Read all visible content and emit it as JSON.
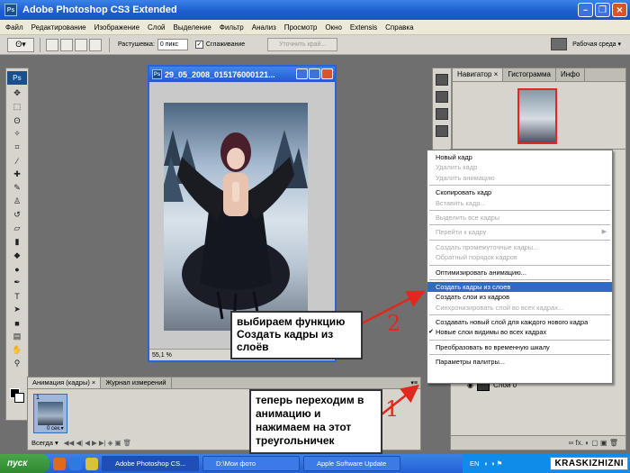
{
  "window": {
    "title": "Adobe Photoshop CS3 Extended",
    "app_icon": "Ps"
  },
  "menubar": {
    "items": [
      "Файл",
      "Редактирование",
      "Изображение",
      "Слой",
      "Выделение",
      "Фильтр",
      "Анализ",
      "Просмотр",
      "Окно",
      "Extensis",
      "Справка"
    ]
  },
  "options": {
    "feather_label": "Растушевка:",
    "feather_value": "0 пикс",
    "antialias_label": "Сглаживание",
    "antialias_checked": "✓",
    "refine_button": "Уточнить край...",
    "workspace_label": "Рабочая среда ▾"
  },
  "tools": {
    "logo": "Ps",
    "icons": [
      "move-icon",
      "marquee-icon",
      "lasso-icon",
      "magic-wand-icon",
      "crop-icon",
      "eyedropper-icon",
      "healing-icon",
      "brush-icon",
      "stamp-icon",
      "history-brush-icon",
      "eraser-icon",
      "gradient-icon",
      "blur-icon",
      "dodge-icon",
      "pen-icon",
      "type-icon",
      "path-select-icon",
      "shape-icon",
      "notes-icon",
      "hand-icon",
      "zoom-icon"
    ]
  },
  "document": {
    "title": "29_05_2008_015176000121...",
    "zoom": "55,1 %"
  },
  "navigator": {
    "tabs": [
      "Навигатор ×",
      "Гистограмма",
      "Инфо"
    ]
  },
  "layers": {
    "layer_name": "Слой 0",
    "bottom_icons": "∞  fx.  ◐  ▢  ▣  🗑"
  },
  "context_menu": {
    "items": [
      {
        "label": "Новый кадр",
        "enabled": true
      },
      {
        "label": "Удалить кадр",
        "enabled": false
      },
      {
        "label": "Удалить анимацию",
        "enabled": false
      },
      {
        "sep": true
      },
      {
        "label": "Скопировать кадр",
        "enabled": true
      },
      {
        "label": "Вставить кадр...",
        "enabled": false
      },
      {
        "sep": true
      },
      {
        "label": "Выделить все кадры",
        "enabled": false
      },
      {
        "sep": true
      },
      {
        "label": "Перейти к кадру",
        "enabled": false,
        "submenu": true
      },
      {
        "sep": true
      },
      {
        "label": "Создать промежуточные кадры...",
        "enabled": false
      },
      {
        "label": "Обратный порядок кадров",
        "enabled": false
      },
      {
        "sep": true
      },
      {
        "label": "Оптимизировать анимацию...",
        "enabled": true
      },
      {
        "sep": true
      },
      {
        "label": "Создать кадры из слоев",
        "enabled": true,
        "highlighted": true
      },
      {
        "label": "Создать слои из кадров",
        "enabled": true
      },
      {
        "label": "Синхронизировать слой во всех кадрах...",
        "enabled": false
      },
      {
        "sep": true
      },
      {
        "label": "Создавать новый слой для каждого нового кадра",
        "enabled": true
      },
      {
        "label": "Новые слои видимы во всех кадрах",
        "enabled": true,
        "checked": true
      },
      {
        "sep": true
      },
      {
        "label": "Преобразовать во временную шкалу",
        "enabled": true
      },
      {
        "sep": true
      },
      {
        "label": "Параметры палитры...",
        "enabled": true
      }
    ]
  },
  "animation_panel": {
    "tabs": [
      "Анимация (кадры) ×",
      "Журнал измерений"
    ],
    "frame_number": "1",
    "frame_delay": "0 сек.▾",
    "loop": "Всегда ▾",
    "controls": "◀◀  ◀|  ◀  ▶  ▶|  ◈  ▣  🗑",
    "menu_button": "▾≡"
  },
  "annotations": {
    "step2_text": "выбираем функцию Создать кадры из слоёв",
    "step1_text": "теперь переходим в анимацию и нажимаем на этот треугольничек",
    "num1": "1",
    "num2": "2",
    "color": "#e0281e"
  },
  "taskbar": {
    "start": "пуск",
    "items": [
      "Adobe Photoshop CS...",
      "D:\\Мои фото",
      "Apple Software Update"
    ],
    "lang": "EN",
    "watermark": "KRASKIZHIZNI"
  }
}
